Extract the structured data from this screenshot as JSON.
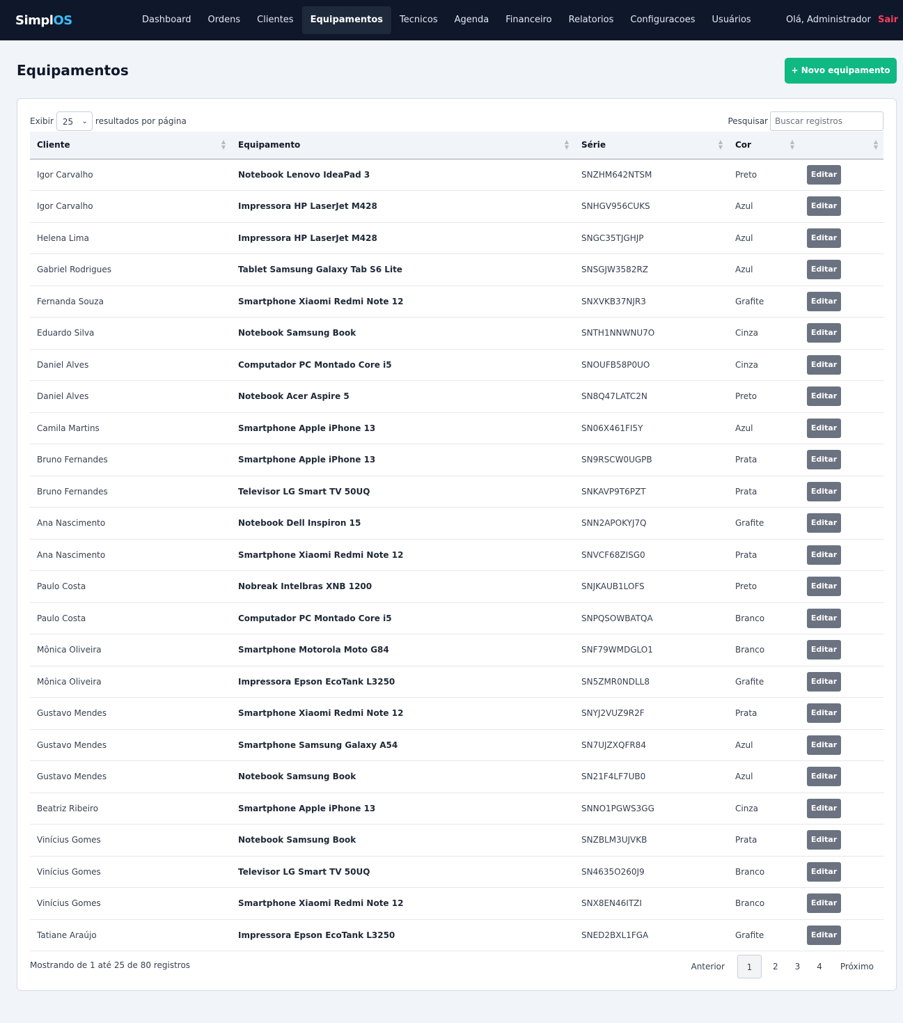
{
  "brand": {
    "prefix": "Simpl",
    "accent": "OS"
  },
  "nav": {
    "items": [
      {
        "label": "Dashboard",
        "active": false
      },
      {
        "label": "Ordens",
        "active": false
      },
      {
        "label": "Clientes",
        "active": false
      },
      {
        "label": "Equipamentos",
        "active": true
      },
      {
        "label": "Tecnicos",
        "active": false
      },
      {
        "label": "Agenda",
        "active": false
      },
      {
        "label": "Financeiro",
        "active": false
      },
      {
        "label": "Relatorios",
        "active": false
      },
      {
        "label": "Configuracoes",
        "active": false
      },
      {
        "label": "Usuários",
        "active": false
      }
    ],
    "greeting": "Olá, Administrador",
    "logout": "Sair"
  },
  "page": {
    "title": "Equipamentos",
    "new_button": "+ Novo equipamento"
  },
  "table_controls": {
    "show_label": "Exibir",
    "page_size": "25",
    "per_page_label": "resultados por página",
    "search_label": "Pesquisar",
    "search_placeholder": "Buscar registros"
  },
  "table": {
    "columns": [
      "Cliente",
      "Equipamento",
      "Série",
      "Cor",
      ""
    ],
    "edit_label": "Editar",
    "rows": [
      {
        "cliente": "Igor Carvalho",
        "equipamento": "Notebook Lenovo IdeaPad 3",
        "serie": "SNZHM642NTSM",
        "cor": "Preto"
      },
      {
        "cliente": "Igor Carvalho",
        "equipamento": "Impressora HP LaserJet M428",
        "serie": "SNHGV956CUKS",
        "cor": "Azul"
      },
      {
        "cliente": "Helena Lima",
        "equipamento": "Impressora HP LaserJet M428",
        "serie": "SNGC35TJGHJP",
        "cor": "Azul"
      },
      {
        "cliente": "Gabriel Rodrigues",
        "equipamento": "Tablet Samsung Galaxy Tab S6 Lite",
        "serie": "SNSGJW3582RZ",
        "cor": "Azul"
      },
      {
        "cliente": "Fernanda Souza",
        "equipamento": "Smartphone Xiaomi Redmi Note 12",
        "serie": "SNXVKB37NJR3",
        "cor": "Grafite"
      },
      {
        "cliente": "Eduardo Silva",
        "equipamento": "Notebook Samsung Book",
        "serie": "SNTH1NNWNU7O",
        "cor": "Cinza"
      },
      {
        "cliente": "Daniel Alves",
        "equipamento": "Computador PC Montado Core i5",
        "serie": "SNOUFB58P0UO",
        "cor": "Cinza"
      },
      {
        "cliente": "Daniel Alves",
        "equipamento": "Notebook Acer Aspire 5",
        "serie": "SN8Q47LATC2N",
        "cor": "Preto"
      },
      {
        "cliente": "Camila Martins",
        "equipamento": "Smartphone Apple iPhone 13",
        "serie": "SN06X461FI5Y",
        "cor": "Azul"
      },
      {
        "cliente": "Bruno Fernandes",
        "equipamento": "Smartphone Apple iPhone 13",
        "serie": "SN9RSCW0UGPB",
        "cor": "Prata"
      },
      {
        "cliente": "Bruno Fernandes",
        "equipamento": "Televisor LG Smart TV 50UQ",
        "serie": "SNKAVP9T6PZT",
        "cor": "Prata"
      },
      {
        "cliente": "Ana Nascimento",
        "equipamento": "Notebook Dell Inspiron 15",
        "serie": "SNN2APOKYJ7Q",
        "cor": "Grafite"
      },
      {
        "cliente": "Ana Nascimento",
        "equipamento": "Smartphone Xiaomi Redmi Note 12",
        "serie": "SNVCF68ZISG0",
        "cor": "Prata"
      },
      {
        "cliente": "Paulo Costa",
        "equipamento": "Nobreak Intelbras XNB 1200",
        "serie": "SNJKAUB1LOFS",
        "cor": "Preto"
      },
      {
        "cliente": "Paulo Costa",
        "equipamento": "Computador PC Montado Core i5",
        "serie": "SNPQSOWBATQA",
        "cor": "Branco"
      },
      {
        "cliente": "Mônica Oliveira",
        "equipamento": "Smartphone Motorola Moto G84",
        "serie": "SNF79WMDGLO1",
        "cor": "Branco"
      },
      {
        "cliente": "Mônica Oliveira",
        "equipamento": "Impressora Epson EcoTank L3250",
        "serie": "SN5ZMR0NDLL8",
        "cor": "Grafite"
      },
      {
        "cliente": "Gustavo Mendes",
        "equipamento": "Smartphone Xiaomi Redmi Note 12",
        "serie": "SNYJ2VUZ9R2F",
        "cor": "Prata"
      },
      {
        "cliente": "Gustavo Mendes",
        "equipamento": "Smartphone Samsung Galaxy A54",
        "serie": "SN7UJZXQFR84",
        "cor": "Azul"
      },
      {
        "cliente": "Gustavo Mendes",
        "equipamento": "Notebook Samsung Book",
        "serie": "SN21F4LF7UB0",
        "cor": "Azul"
      },
      {
        "cliente": "Beatriz Ribeiro",
        "equipamento": "Smartphone Apple iPhone 13",
        "serie": "SNNO1PGWS3GG",
        "cor": "Cinza"
      },
      {
        "cliente": "Vinícius Gomes",
        "equipamento": "Notebook Samsung Book",
        "serie": "SNZBLM3UJVKB",
        "cor": "Prata"
      },
      {
        "cliente": "Vinícius Gomes",
        "equipamento": "Televisor LG Smart TV 50UQ",
        "serie": "SN4635O260J9",
        "cor": "Branco"
      },
      {
        "cliente": "Vinícius Gomes",
        "equipamento": "Smartphone Xiaomi Redmi Note 12",
        "serie": "SNX8EN46ITZI",
        "cor": "Branco"
      },
      {
        "cliente": "Tatiane Araújo",
        "equipamento": "Impressora Epson EcoTank L3250",
        "serie": "SNED2BXL1FGA",
        "cor": "Grafite"
      }
    ]
  },
  "footer": {
    "info": "Mostrando de 1 até 25 de 80 registros",
    "prev": "Anterior",
    "next": "Próximo",
    "pages": [
      "1",
      "2",
      "3",
      "4"
    ],
    "current_page": "1"
  },
  "colors": {
    "topbar": "#0f172a",
    "brand_accent": "#38bdf8",
    "logout": "#f43f5e",
    "primary_button": "#10b981",
    "edit_button": "#6b7280"
  }
}
